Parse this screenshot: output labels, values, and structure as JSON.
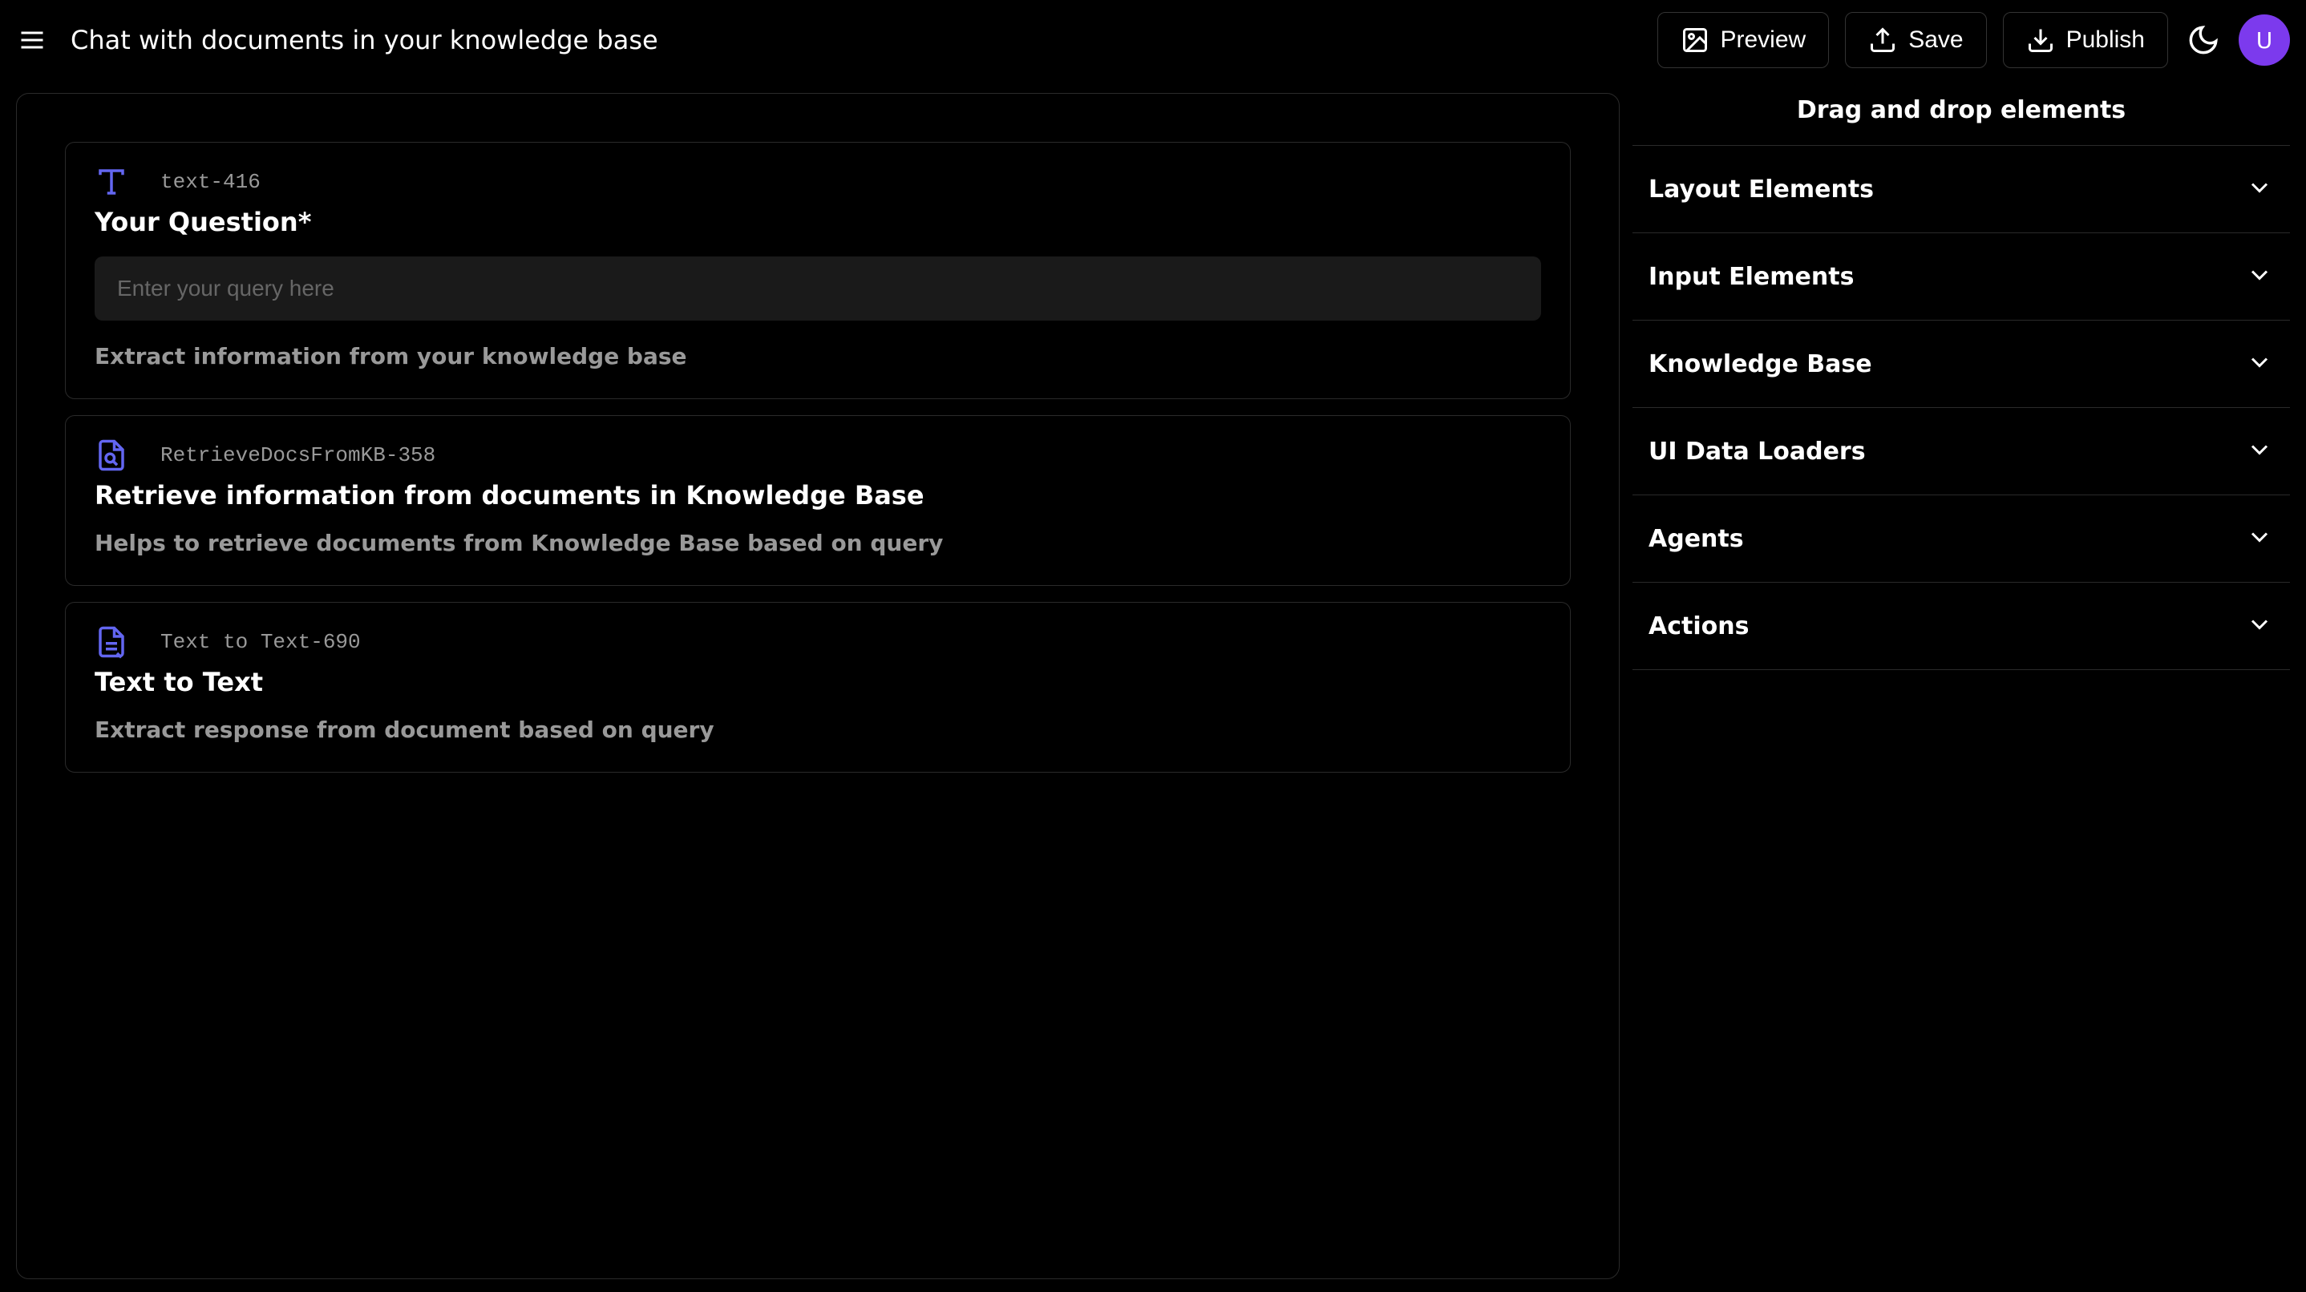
{
  "header": {
    "title": "Chat with documents in your knowledge base",
    "preview_label": "Preview",
    "save_label": "Save",
    "publish_label": "Publish",
    "avatar_initial": "U"
  },
  "canvas": {
    "nodes": [
      {
        "id": "text-416",
        "title": "Your Question*",
        "input_placeholder": "Enter your query here",
        "input_value": "",
        "description": "Extract information from your knowledge base",
        "icon_color": "#6366f1"
      },
      {
        "id": "RetrieveDocsFromKB-358",
        "title": "Retrieve information from documents in Knowledge Base",
        "description": "Helps to retrieve documents from Knowledge Base based on query",
        "icon_color": "#6366f1"
      },
      {
        "id": "Text to Text-690",
        "title": "Text to Text",
        "description": "Extract response from document based on query",
        "icon_color": "#6366f1"
      }
    ]
  },
  "sidebar": {
    "header": "Drag and drop elements",
    "sections": [
      {
        "title": "Layout Elements"
      },
      {
        "title": "Input Elements"
      },
      {
        "title": "Knowledge Base"
      },
      {
        "title": "UI Data Loaders"
      },
      {
        "title": "Agents"
      },
      {
        "title": "Actions"
      }
    ]
  }
}
